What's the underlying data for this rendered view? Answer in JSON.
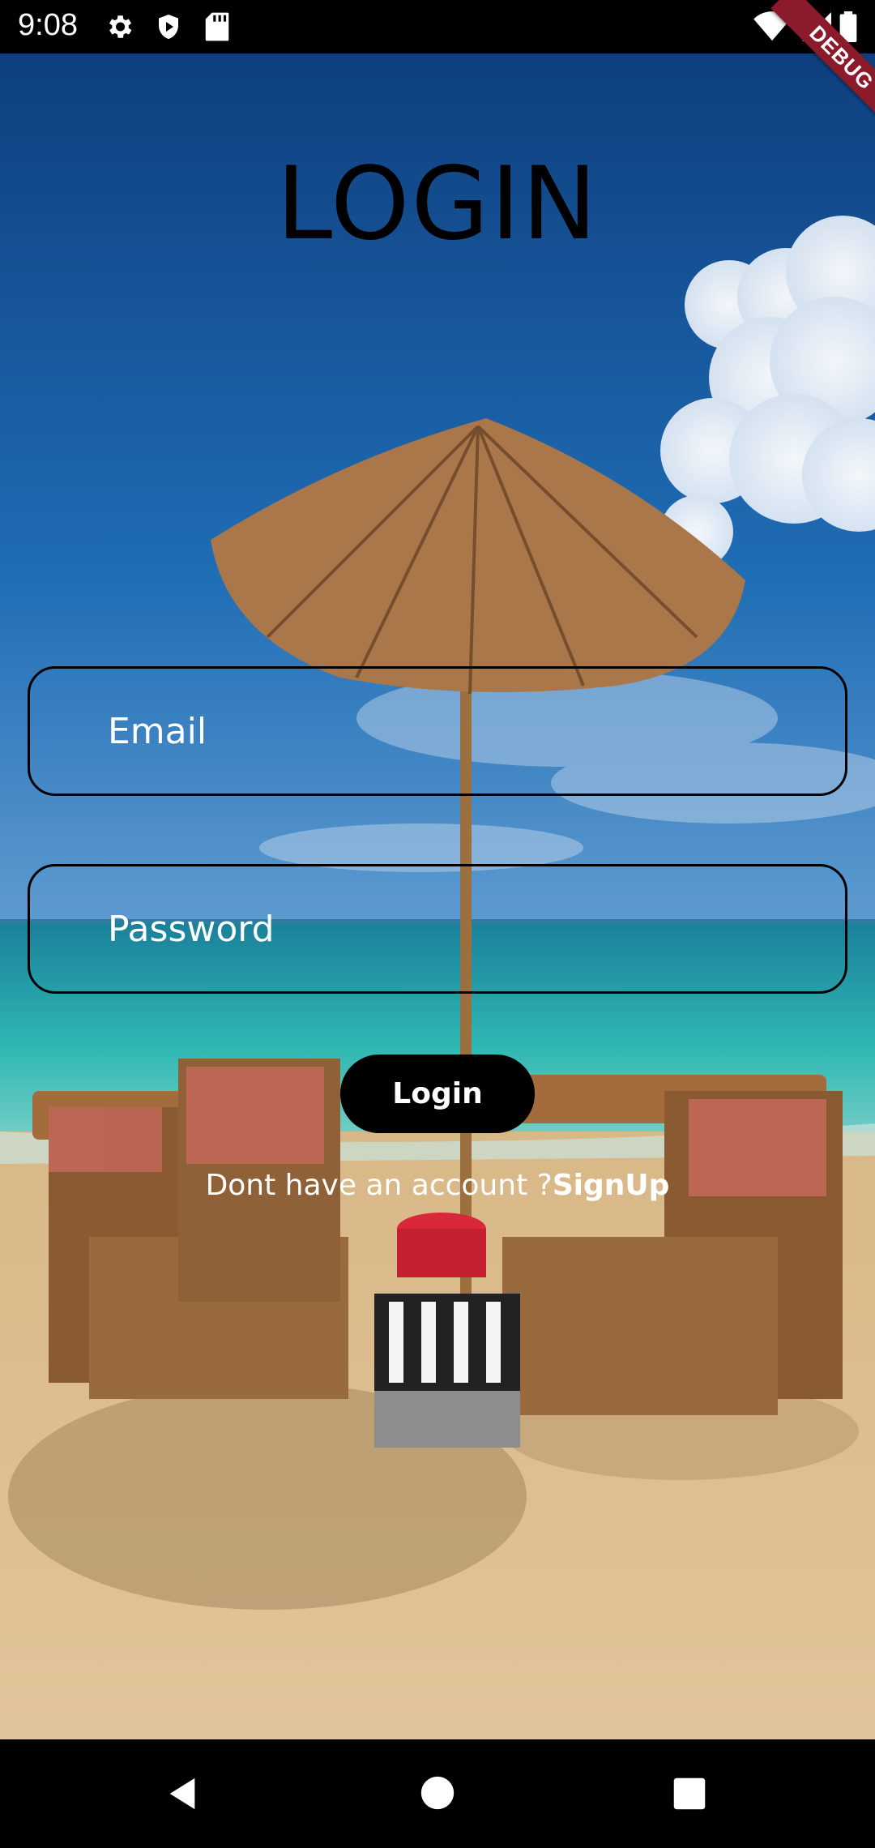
{
  "status_bar": {
    "time": "9:08",
    "icons": [
      "gear-icon",
      "play-protect-icon",
      "sd-card-icon",
      "wifi-icon",
      "signal-icon",
      "battery-icon"
    ]
  },
  "debug_banner": "DEBUG",
  "login": {
    "title": "LOGIN",
    "email_placeholder": "Email",
    "password_placeholder": "Password",
    "button_label": "Login",
    "signup_prompt": "Dont have an account ?",
    "signup_link": "SignUp"
  },
  "nav_bar": {
    "icons": [
      "back-icon",
      "home-icon",
      "recents-icon"
    ]
  },
  "colors": {
    "sky": "#1b5fa3",
    "sea": "#2fb3b0",
    "sand": "#d9b98a",
    "button": "#000000",
    "debug_banner": "#8b1a2b"
  }
}
